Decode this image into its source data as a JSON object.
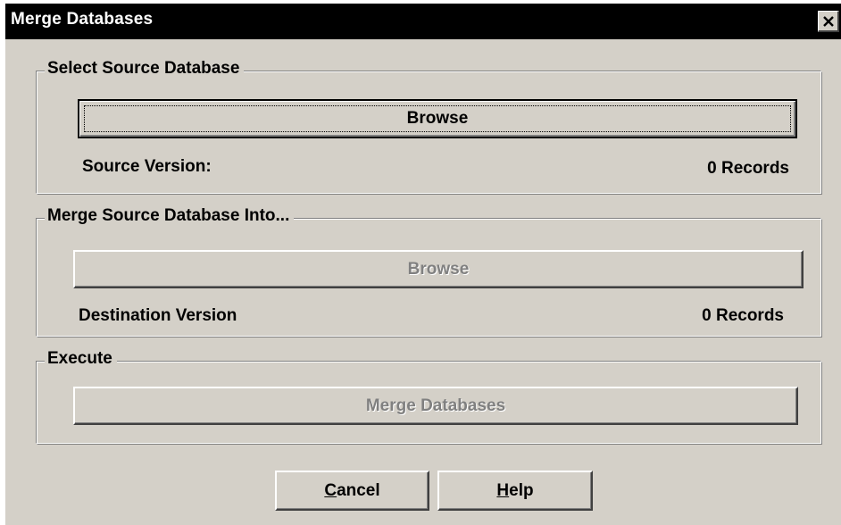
{
  "window": {
    "title": "Merge Databases",
    "close_icon": "close-icon"
  },
  "source_group": {
    "legend": "Select Source Database",
    "browse_label": "Browse",
    "version_label": "Source Version:",
    "records_label": "0 Records"
  },
  "destination_group": {
    "legend": "Merge Source Database Into...",
    "browse_label": "Browse",
    "version_label": "Destination Version",
    "records_label": "0 Records"
  },
  "execute_group": {
    "legend": "Execute",
    "merge_label": "Merge Databases"
  },
  "footer": {
    "cancel_mnemonic": "C",
    "cancel_rest": "ancel",
    "help_mnemonic": "H",
    "help_rest": "elp"
  },
  "colors": {
    "face": "#d4d0c8",
    "titlebar": "#000000",
    "disabled_text": "#808080"
  }
}
